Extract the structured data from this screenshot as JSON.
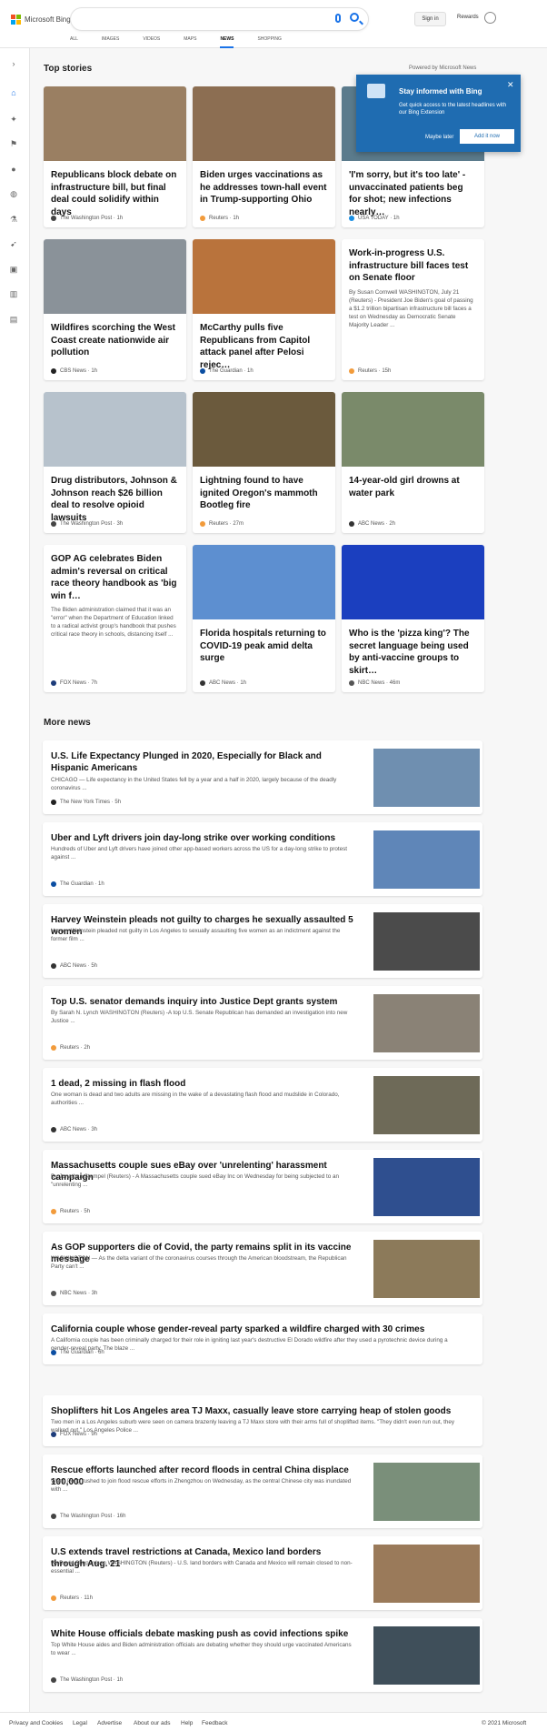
{
  "header": {
    "logo": "Microsoft Bing",
    "search_placeholder": "",
    "signin": "Sign in",
    "rewards": "Rewards"
  },
  "tabs": [
    "ALL",
    "IMAGES",
    "VIDEOS",
    "MAPS",
    "NEWS",
    "SHOPPING"
  ],
  "active_tab": "NEWS",
  "top_stories": {
    "heading": "Top stories",
    "powered_by": "Powered by Microsoft News"
  },
  "popup": {
    "title": "Stay informed with Bing",
    "body": "Get quick access to the latest headlines with our Bing Extension",
    "maybe_later": "Maybe later",
    "add": "Add it now"
  },
  "cards": [
    {
      "title": "Republicans block debate on infrastructure bill, but final deal could solidify within days",
      "snippet": "",
      "source": "The Washington Post · 1h",
      "img": "#9a7f62",
      "dot": "#444"
    },
    {
      "title": "Biden urges vaccinations as he addresses town-hall event in Trump-supporting Ohio",
      "snippet": "",
      "source": "Reuters · 1h",
      "img": "#8c6e52",
      "dot": "#f29b3b"
    },
    {
      "title": "'I'm sorry, but it's too late' - unvaccinated patients beg for shot; new infections nearly…",
      "snippet": "",
      "source": "USA TODAY · 1h",
      "img": "#5b7b8c",
      "dot": "#1a8fe3"
    },
    {
      "title": "Wildfires scorching the West Coast create nationwide air pollution",
      "snippet": "",
      "source": "CBS News · 1h",
      "img": "#8a9299",
      "dot": "#222"
    },
    {
      "title": "McCarthy pulls five Republicans from Capitol attack panel after Pelosi rejec…",
      "snippet": "",
      "source": "The Guardian · 1h",
      "img": "#b9733c",
      "dot": "#0b4ea2"
    },
    {
      "title": "Work-in-progress U.S. infrastructure bill faces test on Senate floor",
      "snippet": "By Susan Cornwell WASHINGTON, July 21 (Reuters) - President Joe Biden's goal of passing a $1.2 trillion bipartisan infrastructure bill faces a test on Wednesday as Democratic Senate Majority Leader ...",
      "source": "Reuters · 15h",
      "img": "",
      "dot": "#f29b3b"
    },
    {
      "title": "Drug distributors, Johnson & Johnson reach $26 billion deal to resolve opioid lawsuits",
      "snippet": "",
      "source": "The Washington Post · 3h",
      "img": "#b7c2cc",
      "dot": "#444"
    },
    {
      "title": "Lightning found to have ignited Oregon's mammoth Bootleg fire",
      "snippet": "",
      "source": "Reuters · 27m",
      "img": "#6b5a3d",
      "dot": "#f29b3b"
    },
    {
      "title": "14-year-old girl drowns at water park",
      "snippet": "",
      "source": "ABC News · 2h",
      "img": "#7a8a6a",
      "dot": "#333"
    },
    {
      "title": "GOP AG celebrates Biden admin's reversal on critical race theory handbook as 'big win f…",
      "snippet": "The Biden administration claimed that it was an \"error\" when the Department of Education linked to a radical activist group's handbook that pushes critical race theory in schools, distancing itself ...",
      "source": "FOX News · 7h",
      "img": "",
      "dot": "#1d3c7a"
    },
    {
      "title": "Florida hospitals returning to COVID-19 peak amid delta surge",
      "snippet": "",
      "source": "ABC News · 1h",
      "img": "#5d8fd0",
      "dot": "#333"
    },
    {
      "title": "Who is the 'pizza king'? The secret language being used by anti-vaccine groups to skirt…",
      "snippet": "",
      "source": "NBC News · 46m",
      "img": "#1b3fbf",
      "dot": "#555"
    }
  ],
  "more_news": {
    "heading": "More news"
  },
  "news": [
    {
      "title": "U.S. Life Expectancy Plunged in 2020, Especially for Black and Hispanic Americans",
      "snippet": "CHICAGO — Life expectancy in the United States fell by a year and a half in 2020, largely because of the deadly coronavirus ...",
      "source": "The New York Times · 5h",
      "img": "#6f8fb0",
      "dot": "#222"
    },
    {
      "title": "Uber and Lyft drivers join day-long strike over working conditions",
      "snippet": "Hundreds of Uber and Lyft drivers have joined other app-based workers across the US for a day-long strike to protest against ...",
      "source": "The Guardian · 1h",
      "img": "#5f86b8",
      "dot": "#0b4ea2"
    },
    {
      "title": "Harvey Weinstein pleads not guilty to charges he sexually assaulted 5 women",
      "snippet": "Harvey Weinstein pleaded not guilty in Los Angeles to sexually assaulting five women as an indictment against the former film ...",
      "source": "ABC News · 5h",
      "img": "#4b4b4b",
      "dot": "#333"
    },
    {
      "title": "Top U.S. senator demands inquiry into Justice Dept grants system",
      "snippet": "By Sarah N. Lynch WASHINGTON (Reuters) -A top U.S. Senate Republican has demanded an investigation into new Justice ...",
      "source": "Reuters · 2h",
      "img": "#8a8276",
      "dot": "#f29b3b"
    },
    {
      "title": "1 dead, 2 missing in flash flood",
      "snippet": "One woman is dead and two adults are missing in the wake of a devastating flash flood and mudslide in Colorado, authorities ...",
      "source": "ABC News · 3h",
      "img": "#6e6a58",
      "dot": "#333"
    },
    {
      "title": "Massachusetts couple sues eBay over 'unrelenting' harassment campaign",
      "snippet": "By Jonathan Stempel (Reuters) - A Massachusetts couple sued eBay Inc on Wednesday for being subjected to an \"unrelenting ...",
      "source": "Reuters · 5h",
      "img": "#2f4f8f",
      "dot": "#f29b3b"
    },
    {
      "title": "As GOP supporters die of Covid, the party remains split in its vaccine message",
      "snippet": "WASHINGTON — As the delta variant of the coronavirus courses through the American bloodstream, the Republican Party can't ...",
      "source": "NBC News · 3h",
      "img": "#8c7a5a",
      "dot": "#555"
    },
    {
      "title": "California couple whose gender-reveal party sparked a wildfire charged with 30 crimes",
      "snippet": "A California couple has been criminally charged for their role in igniting last year's destructive El Dorado wildfire after they used a pyrotechnic device during a gender-reveal party. The blaze ...",
      "source": "The Guardian · 6h",
      "img": "",
      "dot": "#0b4ea2"
    },
    {
      "title": "Shoplifters hit Los Angeles area TJ Maxx, casually leave store carrying heap of stolen goods",
      "snippet": "Two men in a Los Angeles suburb were seen on camera brazenly leaving a TJ Maxx store with their arms full of shoplifted items. \"They didn't even run out, they walked out,\" Los Angeles Police ...",
      "source": "FOX News · 9h",
      "img": "",
      "dot": "#1d3c7a"
    },
    {
      "title": "Rescue efforts launched after record floods in central China displace 100,000",
      "snippet": "Wang Peng rushed to join flood rescue efforts in Zhengzhou on Wednesday, as the central Chinese city was inundated with ...",
      "source": "The Washington Post · 16h",
      "img": "#7a8f7a",
      "dot": "#444"
    },
    {
      "title": "U.S extends travel restrictions at Canada, Mexico land borders through Aug. 21",
      "snippet": "By David Shepardson WASHINGTON (Reuters) - U.S. land borders with Canada and Mexico will remain closed to non-essential ...",
      "source": "Reuters · 11h",
      "img": "#9a7a5a",
      "dot": "#f29b3b"
    },
    {
      "title": "White House officials debate masking push as covid infections spike",
      "snippet": "Top White House aides and Biden administration officials are debating whether they should urge vaccinated Americans to wear ...",
      "source": "The Washington Post · 1h",
      "img": "#3f4f5a",
      "dot": "#444"
    }
  ],
  "footer": {
    "links": [
      "Privacy and Cookies",
      "Legal",
      "Advertise",
      "About our ads",
      "Help",
      "Feedback"
    ],
    "copyright": "© 2021 Microsoft"
  }
}
